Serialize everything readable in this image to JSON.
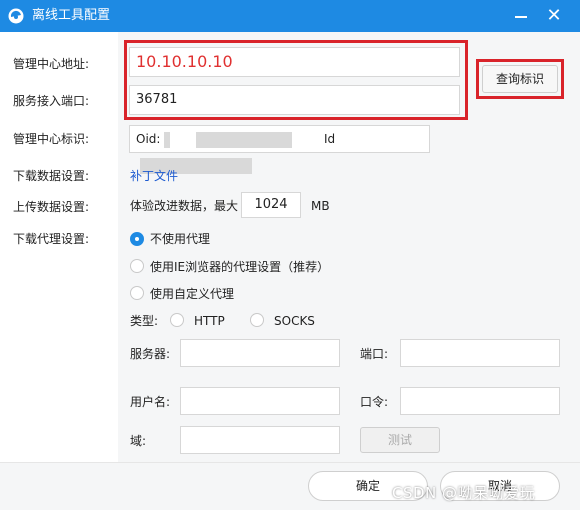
{
  "window": {
    "title": "离线工具配置",
    "logo_icon": "app-logo-icon",
    "minimize_label": "",
    "close_glyph": "✕"
  },
  "labels": {
    "center_address": "管理中心地址:",
    "service_port": "服务接入端口:",
    "center_id": "管理中心标识:",
    "download_setting": "下载数据设置:",
    "upload_setting": "上传数据设置:",
    "proxy_setting": "下载代理设置:"
  },
  "fields": {
    "center_address_value": "10.10.10.10",
    "service_port_value": "36781",
    "oid_label": "Oid:",
    "id_label": "Id"
  },
  "buttons": {
    "query_id": "查询标识",
    "test": "测试",
    "ok": "确定",
    "cancel": "取消"
  },
  "download": {
    "patch_link": "补丁文件"
  },
  "upload": {
    "prefix": "体验改进数据，最大",
    "value": "1024",
    "unit": "MB"
  },
  "proxy": {
    "options": [
      "不使用代理",
      "使用IE浏览器的代理设置（推荐）",
      "使用自定义代理"
    ],
    "selected_index": 0,
    "type_label": "类型:",
    "type_options": [
      "HTTP",
      "SOCKS"
    ],
    "server_label": "服务器:",
    "port_label": "端口:",
    "username_label": "用户名:",
    "password_label": "口令:",
    "domain_label": "域:"
  },
  "watermark": "CSDN @呦呆呦爱玩",
  "colors": {
    "titlebar": "#1e8ae3",
    "highlight_red": "#d9232a",
    "link_blue": "#1e5bd0"
  }
}
